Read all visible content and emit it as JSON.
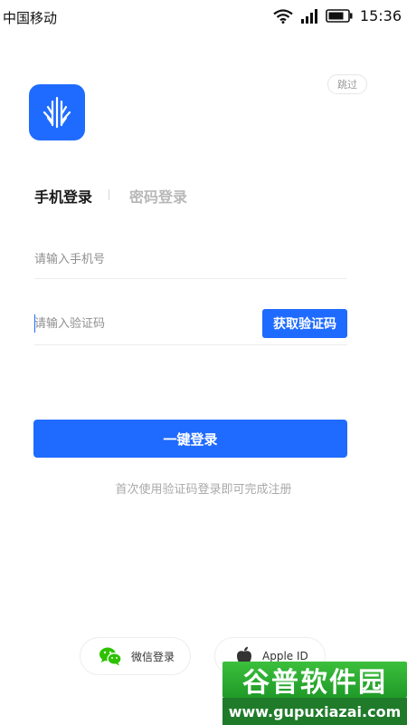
{
  "status_bar": {
    "carrier": "中国移动",
    "time": "15:36",
    "icons": [
      "wifi-icon",
      "signal-icon",
      "battery-icon"
    ]
  },
  "skip": {
    "label": "跳过"
  },
  "logo": {
    "icon": "app-logo-icon",
    "color": "#1f6bff"
  },
  "tabs": [
    {
      "label": "手机登录",
      "active": true
    },
    {
      "label": "密码登录",
      "active": false
    }
  ],
  "phone_field": {
    "placeholder": "请输入手机号",
    "value": ""
  },
  "code_field": {
    "placeholder": "请输入验证码",
    "value": ""
  },
  "get_code_button": {
    "label": "获取验证码"
  },
  "login_button": {
    "label": "一键登录"
  },
  "hint": "首次使用验证码登录即可完成注册",
  "social": [
    {
      "label": "微信登录",
      "icon": "wechat-icon"
    },
    {
      "label": "Apple ID",
      "icon": "apple-icon"
    }
  ],
  "watermark": {
    "title": "谷普软件园",
    "url": "www.gupuxiazai.com"
  },
  "colors": {
    "accent": "#1f6bff",
    "wechat": "#2dc100"
  }
}
